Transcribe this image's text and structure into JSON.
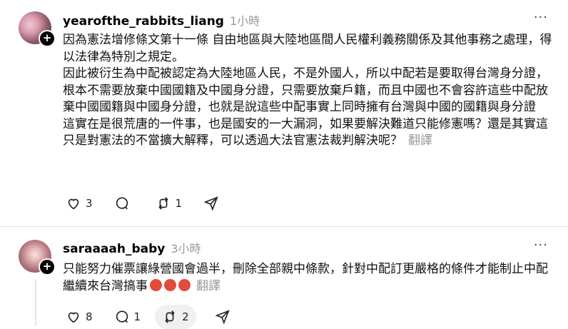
{
  "post1": {
    "username": "yearofthe_rabbits_liang",
    "time": "1小時",
    "more": "···",
    "paragraphs": [
      "因為憲法增修條文第十一條 自由地區與大陸地區間人民權利義務關係及其他事務之處理，得以法律為特別之規定。",
      "因此被衍生為中配被認定為大陸地區人民，不是外國人，所以中配若是要取得台灣身分證，根本不需要放棄中國國籍及中國身分證，只需要放棄戶籍，而且中國也不會容許這些中配放棄中國國籍與中國身分證，也就是說這些中配事實上同時擁有台灣與中國的國籍與身分證",
      "這實在是很荒唐的一件事，也是國安的一大漏洞，如果要解決難道只能修憲嗎？還是其實這只是對憲法的不當擴大解釋，可以透過大法官憲法裁判解決呢？"
    ],
    "translate": "翻譯",
    "likes": "3",
    "comments": "",
    "reposts": "1",
    "icons": [
      "heart-icon",
      "comment-icon",
      "repost-icon",
      "share-icon"
    ]
  },
  "post2": {
    "username": "saraaaah_baby",
    "time": "3小時",
    "more": "···",
    "text": "只能努力催票讓綠營國會過半，刪除全部親中條款，針對中配訂更嚴格的條件才能制止中配繼續來台灣搞事",
    "emoji_count": 3,
    "emoji_name": "angry-face-emoji",
    "translate": "翻譯",
    "likes": "8",
    "comments": "1",
    "reposts": "2",
    "icons": [
      "heart-icon",
      "comment-icon",
      "repost-icon",
      "share-icon"
    ]
  },
  "colors": {
    "muted": "#999999",
    "text": "#111111",
    "divider": "#e0e0e0"
  }
}
